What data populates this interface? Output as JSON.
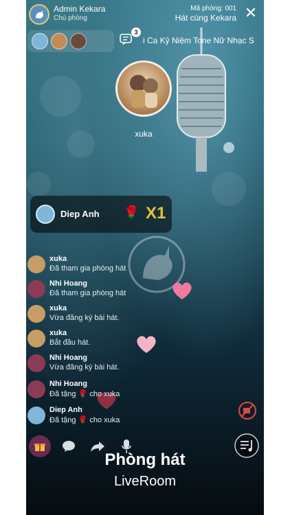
{
  "header": {
    "host_name": "Admin Kekara",
    "host_role": "Chú phòng",
    "room_code": "Mã phòng: 001",
    "room_name": "Hát cùng Kekara",
    "close": "✕"
  },
  "queue": {
    "count": "3"
  },
  "song_ticker": "i Ca Kỷ Niệm  Tone Nữ  Nhạc S",
  "singer": {
    "name": "xuka"
  },
  "gift_banner": {
    "user": "Diep Anh",
    "multiplier": "X1",
    "gift_icon": "rose-icon"
  },
  "feed": {
    "messages": [
      {
        "user": "xuka",
        "text": "Đã tham gia phòng hát"
      },
      {
        "user": "Nhi Hoang",
        "text": "Đã tham gia phòng hát"
      },
      {
        "user": "xuka",
        "text": "Vừa đăng ký bài hát."
      },
      {
        "user": "xuka",
        "text": "Bắt đầu hát."
      },
      {
        "user": "Nhi Hoang",
        "text": "Vừa đăng ký bài hát."
      },
      {
        "user": "Nhi Hoang",
        "text_before": "Đã tặng",
        "text_after": "cho xuka"
      },
      {
        "user": "Diep Anh",
        "text_before": "Đã tặng",
        "text_after": "cho xuka"
      }
    ]
  },
  "footer": {
    "title": "Phòng hát",
    "subtitle": "LiveRoom"
  },
  "colors": {
    "accent_gold": "#e8c23a",
    "rose": "#e03a5a"
  }
}
